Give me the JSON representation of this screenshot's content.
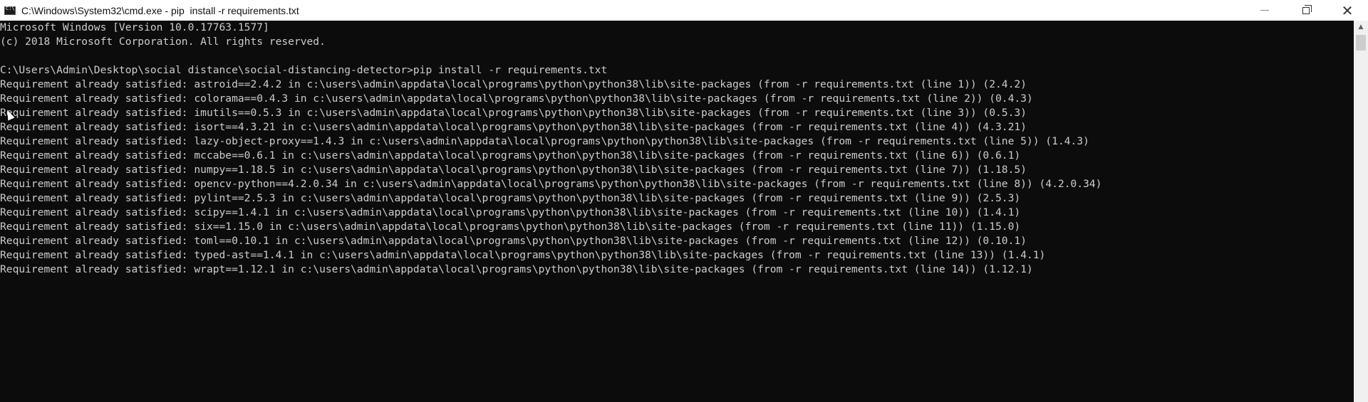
{
  "window": {
    "title": "C:\\Windows\\System32\\cmd.exe - pip  install -r requirements.txt",
    "minimize_icon": "minimize-icon",
    "maximize_icon": "restore-icon",
    "close_icon": "close-icon",
    "close_glyph": "✕"
  },
  "console": {
    "lines": [
      "Microsoft Windows [Version 10.0.17763.1577]",
      "(c) 2018 Microsoft Corporation. All rights reserved.",
      "",
      "C:\\Users\\Admin\\Desktop\\social distance\\social-distancing-detector>pip install -r requirements.txt",
      "Requirement already satisfied: astroid==2.4.2 in c:\\users\\admin\\appdata\\local\\programs\\python\\python38\\lib\\site-packages (from -r requirements.txt (line 1)) (2.4.2)",
      "Requirement already satisfied: colorama==0.4.3 in c:\\users\\admin\\appdata\\local\\programs\\python\\python38\\lib\\site-packages (from -r requirements.txt (line 2)) (0.4.3)",
      "Requirement already satisfied: imutils==0.5.3 in c:\\users\\admin\\appdata\\local\\programs\\python\\python38\\lib\\site-packages (from -r requirements.txt (line 3)) (0.5.3)",
      "Requirement already satisfied: isort==4.3.21 in c:\\users\\admin\\appdata\\local\\programs\\python\\python38\\lib\\site-packages (from -r requirements.txt (line 4)) (4.3.21)",
      "Requirement already satisfied: lazy-object-proxy==1.4.3 in c:\\users\\admin\\appdata\\local\\programs\\python\\python38\\lib\\site-packages (from -r requirements.txt (line 5)) (1.4.3)",
      "Requirement already satisfied: mccabe==0.6.1 in c:\\users\\admin\\appdata\\local\\programs\\python\\python38\\lib\\site-packages (from -r requirements.txt (line 6)) (0.6.1)",
      "Requirement already satisfied: numpy==1.18.5 in c:\\users\\admin\\appdata\\local\\programs\\python\\python38\\lib\\site-packages (from -r requirements.txt (line 7)) (1.18.5)",
      "Requirement already satisfied: opencv-python==4.2.0.34 in c:\\users\\admin\\appdata\\local\\programs\\python\\python38\\lib\\site-packages (from -r requirements.txt (line 8)) (4.2.0.34)",
      "Requirement already satisfied: pylint==2.5.3 in c:\\users\\admin\\appdata\\local\\programs\\python\\python38\\lib\\site-packages (from -r requirements.txt (line 9)) (2.5.3)",
      "Requirement already satisfied: scipy==1.4.1 in c:\\users\\admin\\appdata\\local\\programs\\python\\python38\\lib\\site-packages (from -r requirements.txt (line 10)) (1.4.1)",
      "Requirement already satisfied: six==1.15.0 in c:\\users\\admin\\appdata\\local\\programs\\python\\python38\\lib\\site-packages (from -r requirements.txt (line 11)) (1.15.0)",
      "Requirement already satisfied: toml==0.10.1 in c:\\users\\admin\\appdata\\local\\programs\\python\\python38\\lib\\site-packages (from -r requirements.txt (line 12)) (0.10.1)",
      "Requirement already satisfied: typed-ast==1.4.1 in c:\\users\\admin\\appdata\\local\\programs\\python\\python38\\lib\\site-packages (from -r requirements.txt (line 13)) (1.4.1)",
      "Requirement already satisfied: wrapt==1.12.1 in c:\\users\\admin\\appdata\\local\\programs\\python\\python38\\lib\\site-packages (from -r requirements.txt (line 14)) (1.12.1)"
    ]
  },
  "scrollbar": {
    "up_glyph": "▲"
  }
}
